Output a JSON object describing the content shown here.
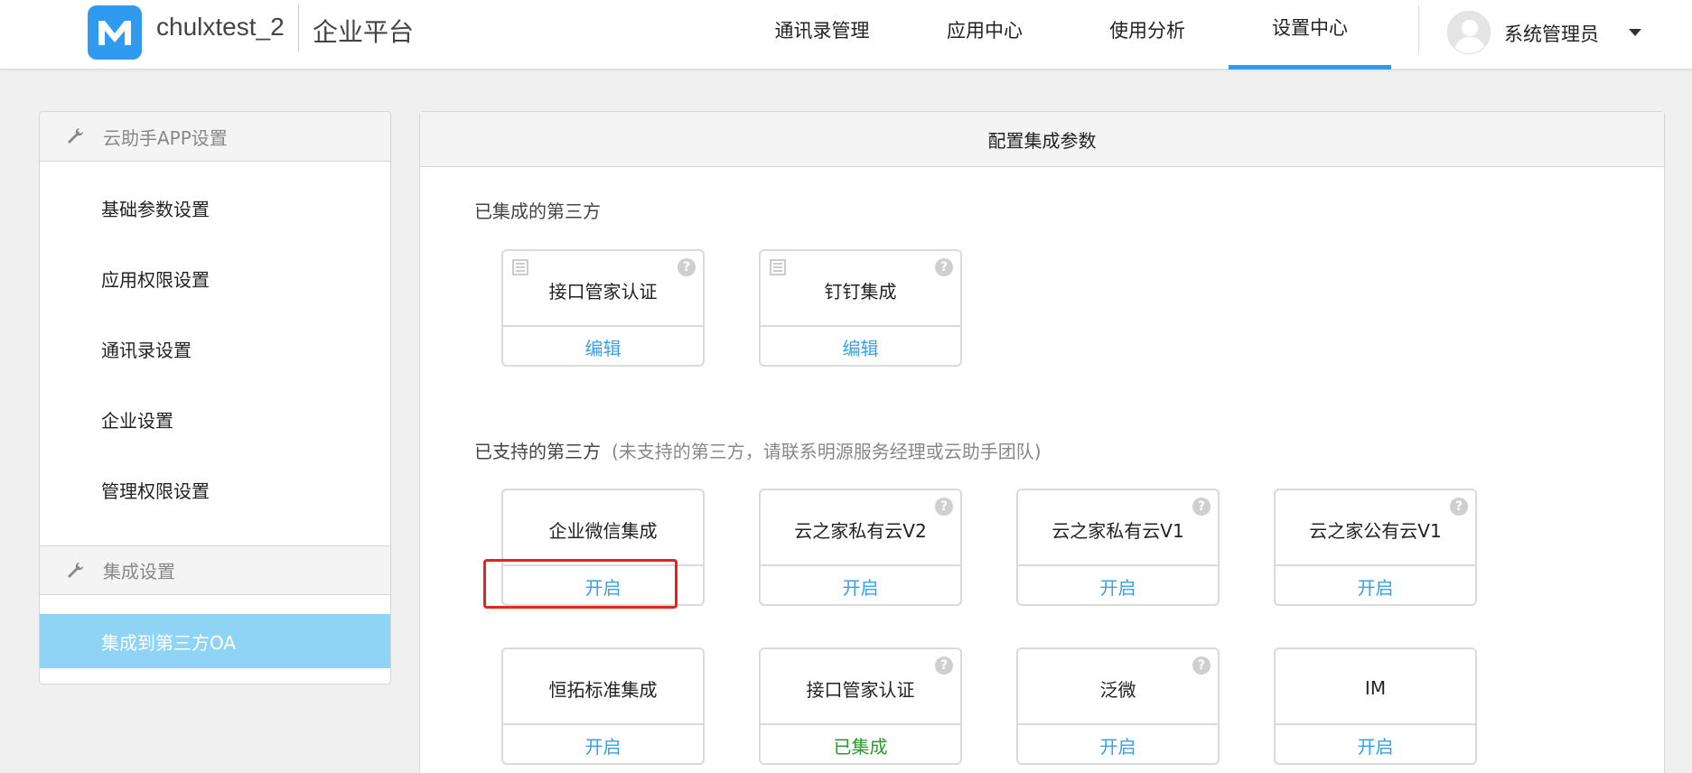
{
  "header": {
    "logo_letter": "M",
    "tenant_name": "chulxtest_2",
    "platform_name": "企业平台",
    "nav": [
      {
        "label": "通讯录管理",
        "active": false
      },
      {
        "label": "应用中心",
        "active": false
      },
      {
        "label": "使用分析",
        "active": false
      },
      {
        "label": "设置中心",
        "active": true
      }
    ],
    "user_name": "系统管理员",
    "accent_color": "#2f9bf0"
  },
  "sidebar": {
    "groups": [
      {
        "label": "云助手APP设置",
        "items": [
          "基础参数设置",
          "应用权限设置",
          "通讯录设置",
          "企业设置",
          "管理权限设置"
        ]
      },
      {
        "label": "集成设置",
        "items": [
          "集成到第三方OA"
        ]
      }
    ],
    "active_item": "集成到第三方OA",
    "active_color": "#8fd4f5"
  },
  "main": {
    "title": "配置集成参数",
    "integrated_title": "已集成的第三方",
    "integrated": [
      {
        "name": "接口管家认证",
        "action": "编辑"
      },
      {
        "name": "钉钉集成",
        "action": "编辑"
      }
    ],
    "supported_title": "已支持的第三方",
    "supported_hint": "(未支持的第三方，请联系明源服务经理或云助手团队)",
    "supported": [
      {
        "name": "企业微信集成",
        "action": "开启",
        "help": false,
        "highlighted": true
      },
      {
        "name": "云之家私有云V2",
        "action": "开启",
        "help": true
      },
      {
        "name": "云之家私有云V1",
        "action": "开启",
        "help": true
      },
      {
        "name": "云之家公有云V1",
        "action": "开启",
        "help": true
      },
      {
        "name": "恒拓标准集成",
        "action": "开启",
        "help": false
      },
      {
        "name": "接口管家认证",
        "action": "已集成",
        "help": true,
        "done": true
      },
      {
        "name": "泛微",
        "action": "开启",
        "help": true
      },
      {
        "name": "IM",
        "action": "开启",
        "help": false
      }
    ],
    "help_glyph": "?",
    "link_color": "#3aa0e8",
    "done_color": "#2e9a2e",
    "highlight_color": "#e3241b"
  }
}
